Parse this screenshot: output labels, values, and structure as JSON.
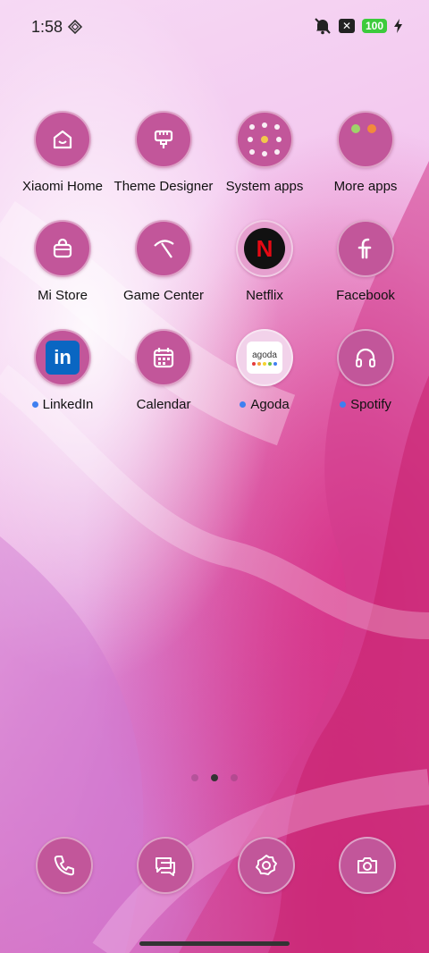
{
  "status_bar": {
    "time": "1:58",
    "battery": "100",
    "icons": [
      "gem-icon",
      "mute-icon",
      "notification-box-icon",
      "charging-bolt-icon"
    ]
  },
  "apps": [
    {
      "label": "Xiaomi Home",
      "icon": "house-icon",
      "new": false
    },
    {
      "label": "Theme Designer",
      "icon": "brush-icon",
      "new": false
    },
    {
      "label": "System apps",
      "icon": "folder-icon",
      "new": false
    },
    {
      "label": "More apps",
      "icon": "folder-icon",
      "new": false
    },
    {
      "label": "Mi Store",
      "icon": "shopping-bag-icon",
      "new": false
    },
    {
      "label": "Game Center",
      "icon": "game-icon",
      "new": false
    },
    {
      "label": "Netflix",
      "icon": "netflix-logo",
      "logo_text": "N",
      "new": false
    },
    {
      "label": "Facebook",
      "icon": "facebook-icon",
      "new": false
    },
    {
      "label": "LinkedIn",
      "icon": "linkedin-logo",
      "logo_text": "in",
      "new": true
    },
    {
      "label": "Calendar",
      "icon": "calendar-icon",
      "new": false
    },
    {
      "label": "Agoda",
      "icon": "agoda-logo",
      "logo_text": "agoda",
      "new": true
    },
    {
      "label": "Spotify",
      "icon": "headphones-icon",
      "new": true
    }
  ],
  "dock": [
    {
      "icon": "phone-icon"
    },
    {
      "icon": "messages-icon"
    },
    {
      "icon": "settings-icon"
    },
    {
      "icon": "camera-icon"
    }
  ],
  "pages": {
    "count": 3,
    "active": 2
  },
  "colors": {
    "icon_bg": "#c2569a",
    "new_dot": "#3f7ff0",
    "battery": "#3ccb3c",
    "netflix_red": "#e50914",
    "linkedin_blue": "#0a66c2"
  }
}
